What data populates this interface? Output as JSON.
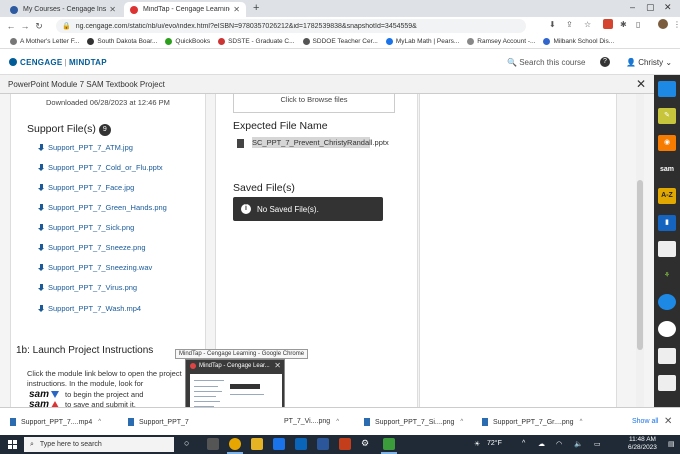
{
  "browser": {
    "tabs": [
      {
        "label": "My Courses - Cengage Instructio",
        "active": false
      },
      {
        "label": "MindTap - Cengage Learning",
        "active": true
      }
    ],
    "new_tab": "+",
    "url": "ng.cengage.com/static/nb/ui/evo/index.html?eISBN=9780357026212&id=1782539838&snapshotId=3454559&",
    "bookmarks": [
      "A Mother's Letter F...",
      "South Dakota Boar...",
      "QuickBooks",
      "SDSTE - Graduate C...",
      "SDDOE Teacher Cer...",
      "MyLab Math | Pears...",
      "Ramsey Account -...",
      "Milbank School Dis..."
    ]
  },
  "header": {
    "logo_brand": "CENGAGE",
    "logo_product": "MINDTAP",
    "search_label": "Search this course",
    "help": "?",
    "user": "Christy"
  },
  "activity": {
    "title": "PowerPoint Module 7 SAM Textbook Project",
    "close": "✕"
  },
  "left_panel": {
    "downloaded": "Downloaded 06/28/2023 at 12:46 PM",
    "support_heading": "Support File(s)",
    "support_count": "9",
    "files": [
      "Support_PPT_7_ATM.jpg",
      "Support_PPT_7_Cold_or_Flu.pptx",
      "Support_PPT_7_Face.jpg",
      "Support_PPT_7_Green_Hands.png",
      "Support_PPT_7_Sick.png",
      "Support_PPT_7_Sneeze.png",
      "Support_PPT_7_Sneezing.wav",
      "Support_PPT_7_Virus.png",
      "Support_PPT_7_Wash.mp4"
    ],
    "launch_heading": "1b: Launch Project Instructions",
    "launch_text": "Click the module link below to open the project instructions. In the module, look for",
    "sam_logo": "sam",
    "step1": "to begin the project and",
    "step2": "to save and submit it."
  },
  "middle_panel": {
    "browse": "Click to Browse files",
    "expected_heading": "Expected File Name",
    "expected_file": "SC_PPT_7_Prevent_ChristyRandall.pptx",
    "saved_heading": "Saved File(s)",
    "saved_message": "No Saved File(s)."
  },
  "hover": {
    "tooltip": "MindTap - Cengage Learning - Google Chrome",
    "thumb_title": "MindTap - Cengage Lear..."
  },
  "downloads": {
    "items": [
      "Support_PPT_7....mp4",
      "Support_PPT_7",
      "PT_7_Vi....png",
      "Support_PPT_7_Si....png",
      "Support_PPT_7_Gr....png"
    ],
    "show_all": "Show all"
  },
  "taskbar": {
    "search_placeholder": "Type here to search",
    "weather": "72°F",
    "time": "11:48 AM",
    "date": "6/28/2023"
  },
  "colors": {
    "brand_blue": "#005b96",
    "link_blue": "#1a5a98",
    "dark_panel": "#333333",
    "taskbar": "#1f2a36"
  }
}
